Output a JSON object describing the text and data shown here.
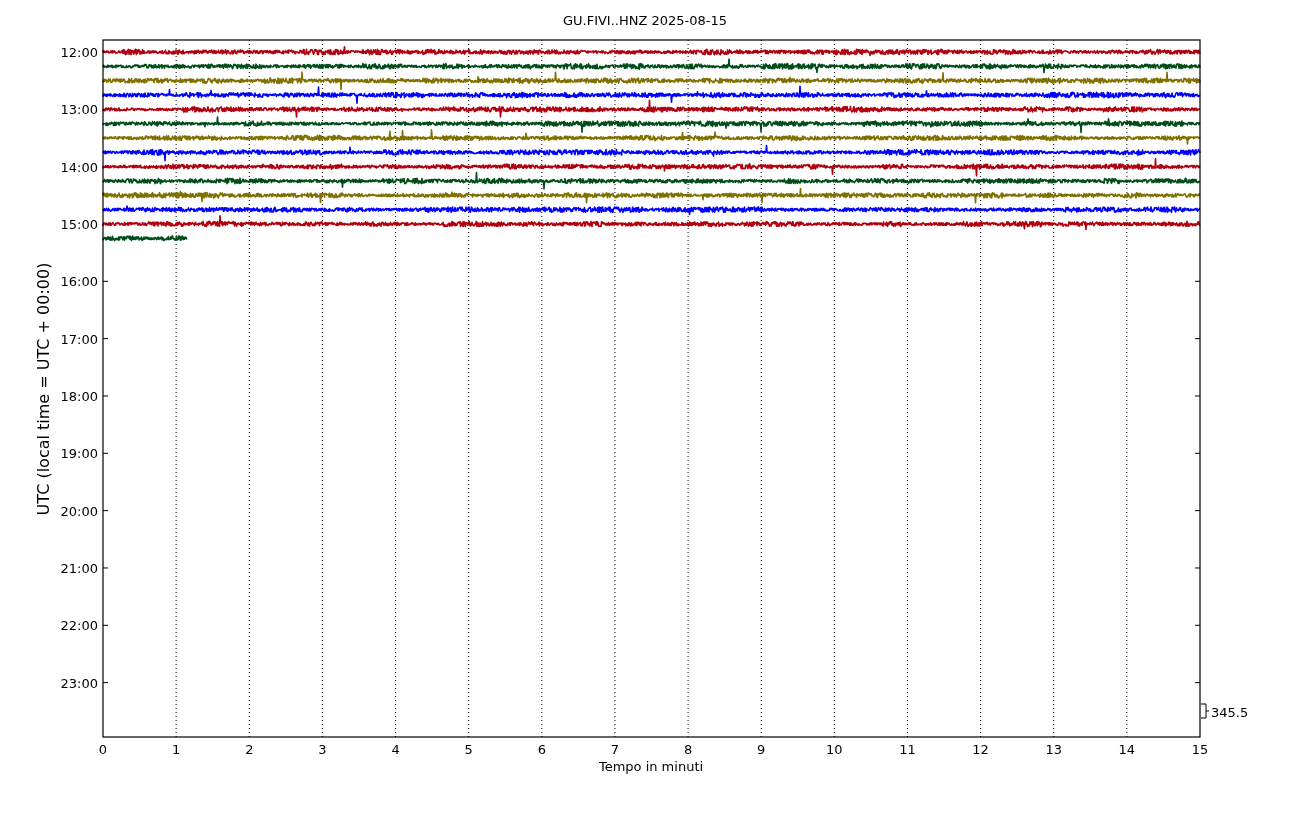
{
  "title": "GU.FIVI..HNZ 2025-08-15",
  "ylabel": "UTC (local time = UTC + 00:00)",
  "xlabel": "Tempo in minuti",
  "yticks": [
    "12:00",
    "13:00",
    "14:00",
    "15:00",
    "16:00",
    "17:00",
    "18:00",
    "19:00",
    "20:00",
    "21:00",
    "22:00",
    "23:00"
  ],
  "xticks": [
    "0",
    "1",
    "2",
    "3",
    "4",
    "5",
    "6",
    "7",
    "8",
    "9",
    "10",
    "11",
    "12",
    "13",
    "14",
    "15"
  ],
  "scale_label": "345.5",
  "traces": [
    {
      "color": "#b0000f",
      "level": 1
    },
    {
      "color": "#004d1a",
      "level": 1
    },
    {
      "color": "#807000",
      "level": 1
    },
    {
      "color": "#0000ff",
      "level": 1
    },
    {
      "color": "#b0000f",
      "level": 1
    },
    {
      "color": "#004d1a",
      "level": 1
    },
    {
      "color": "#807000",
      "level": 1
    },
    {
      "color": "#0000ff",
      "level": 1
    },
    {
      "color": "#b0000f",
      "level": 1
    },
    {
      "color": "#004d1a",
      "level": 1
    },
    {
      "color": "#807000",
      "level": 1
    },
    {
      "color": "#0000ff",
      "level": 1
    },
    {
      "color": "#b0000f",
      "level": 1
    },
    {
      "color": "#004d1a",
      "level": 0.077
    }
  ]
}
